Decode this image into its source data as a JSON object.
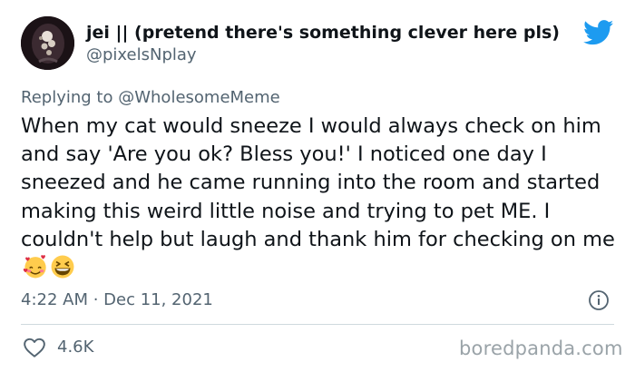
{
  "author": {
    "display_name": "jei || (pretend there's something clever here pls)",
    "handle": "@pixelsNplay",
    "avatar_icon": "avatar-image"
  },
  "brand_icon": "twitter-bird-icon",
  "brand_color": "#1d9bf0",
  "reply": {
    "prefix": "Replying to",
    "mention": "@WholesomeMeme"
  },
  "tweet": {
    "text": "When my cat would sneeze I would always check on him and say 'Are you ok? Bless you!' I noticed one day I sneezed and he came running into the room and started making this weird little noise and trying to pet ME. I couldn't help but laugh and thank him for checking on me",
    "emojis": [
      "smiling-face-with-hearts-emoji",
      "grinning-squinting-face-emoji"
    ]
  },
  "timestamp": "4:22 AM · Dec 11, 2021",
  "metrics": {
    "likes": "4.6K"
  },
  "watermark": "boredpanda.com"
}
